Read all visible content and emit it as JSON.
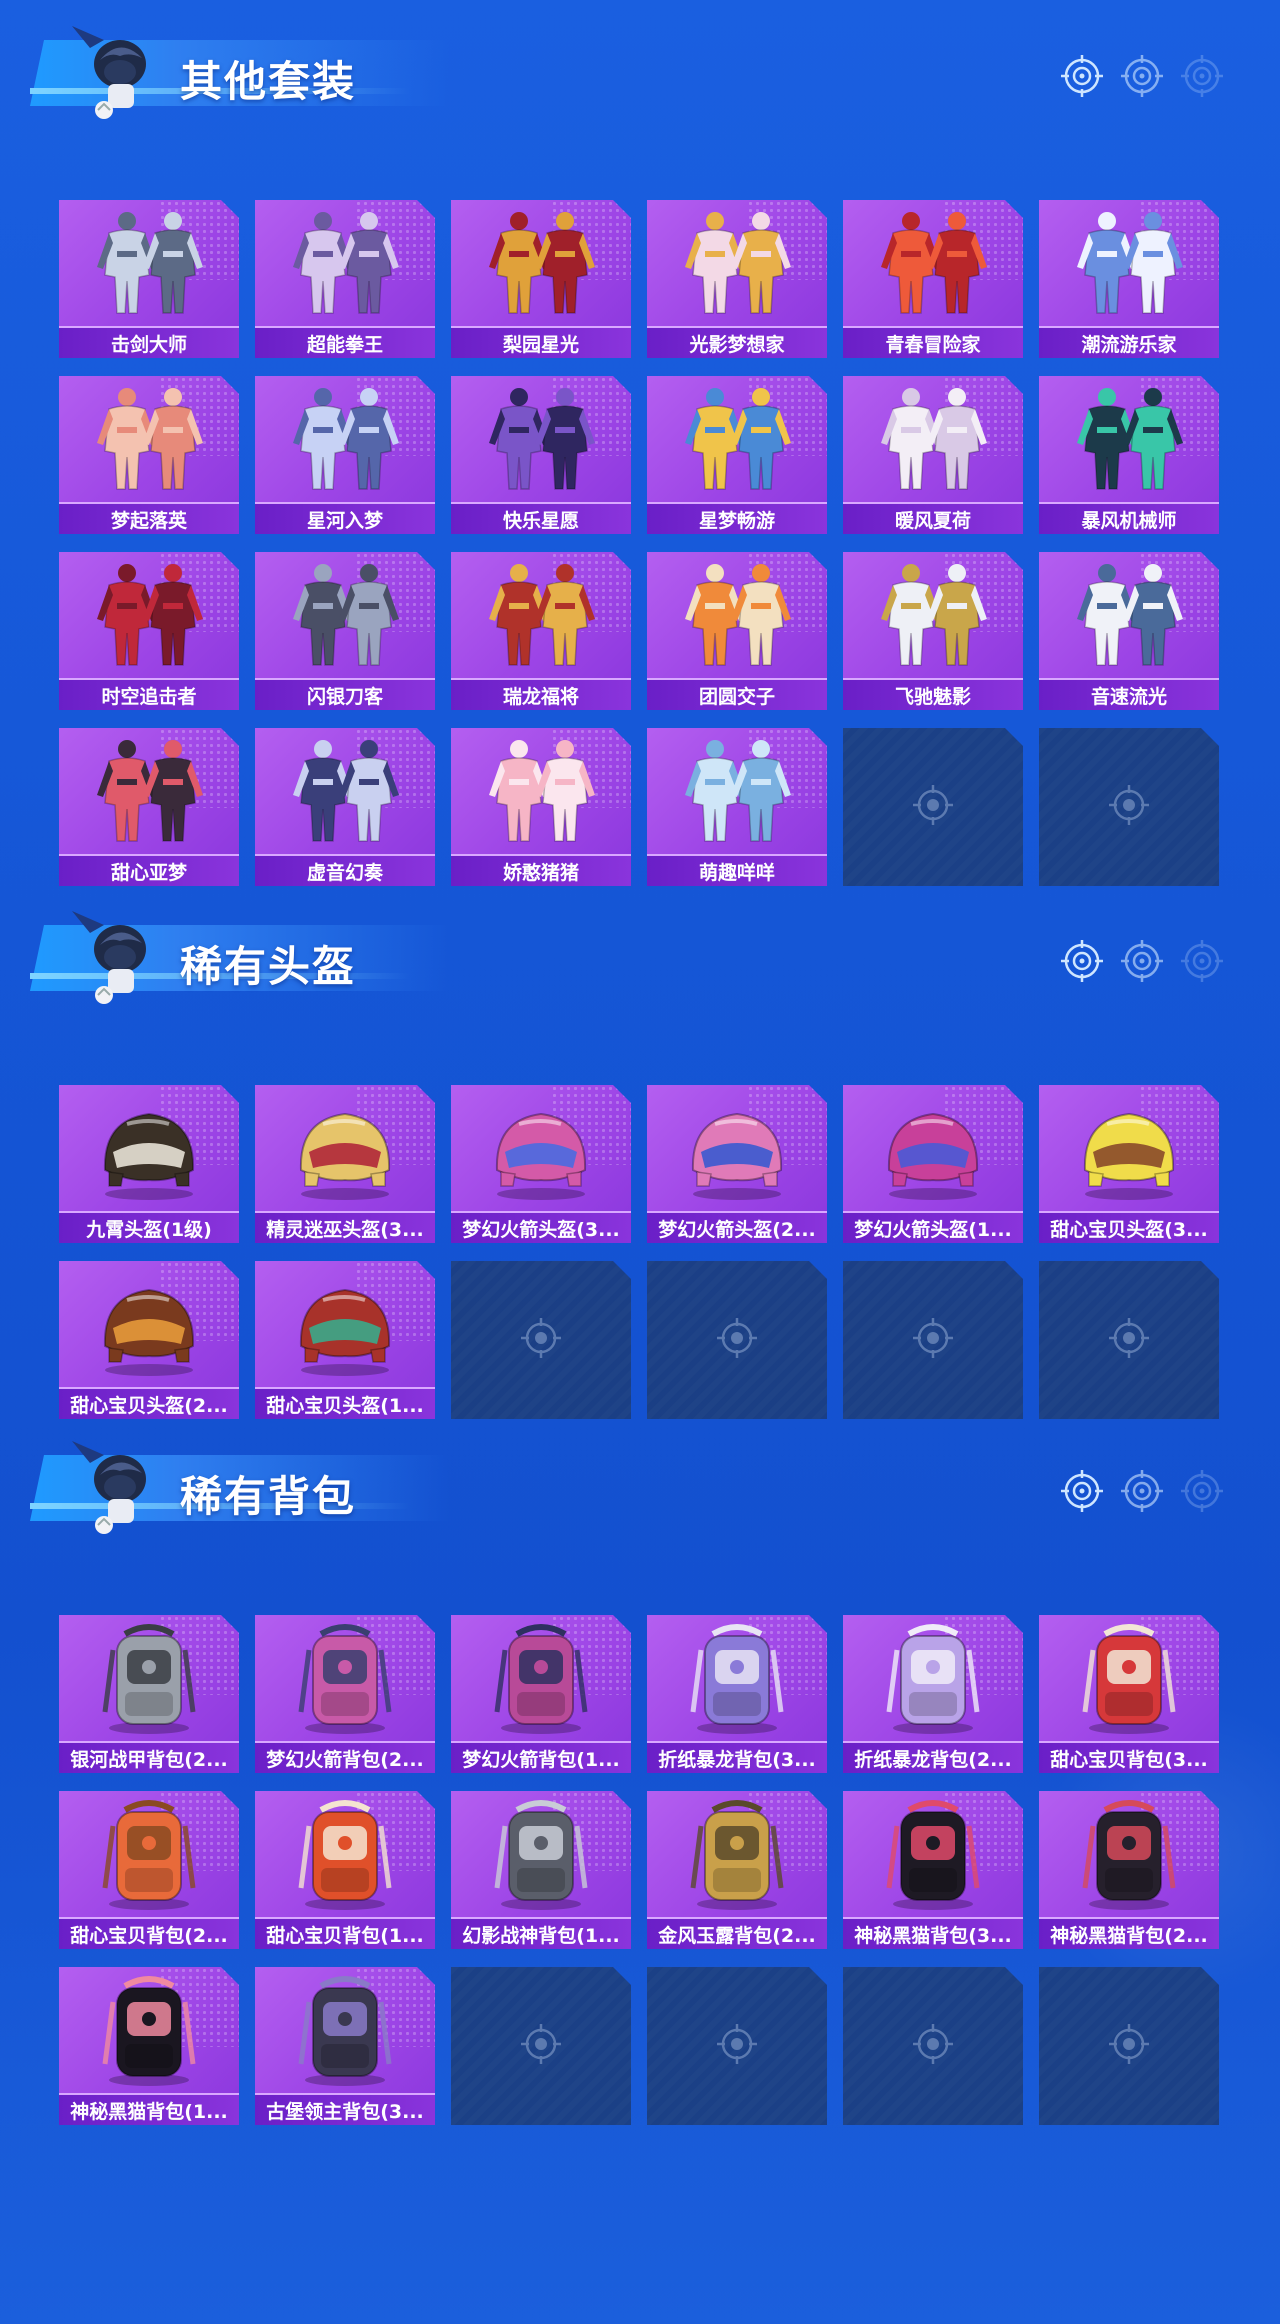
{
  "sections": [
    {
      "title": "其他套装",
      "items": [
        {
          "label": "击剑大师",
          "kind": "suit",
          "c1": "#c9d3e6",
          "c2": "#5c6a86"
        },
        {
          "label": "超能拳王",
          "kind": "suit",
          "c1": "#d7c7ee",
          "c2": "#6b5aa0"
        },
        {
          "label": "梨园星光",
          "kind": "suit",
          "c1": "#e0a13a",
          "c2": "#a0202a"
        },
        {
          "label": "光影梦想家",
          "kind": "suit",
          "c1": "#f3d9e6",
          "c2": "#e8b04a"
        },
        {
          "label": "青春冒险家",
          "kind": "suit",
          "c1": "#ee5a3a",
          "c2": "#b8262a"
        },
        {
          "label": "潮流游乐家",
          "kind": "suit",
          "c1": "#6a8fe0",
          "c2": "#eef2ff"
        },
        {
          "label": "梦起落英",
          "kind": "suit",
          "c1": "#f4c2b0",
          "c2": "#e78a7a"
        },
        {
          "label": "星河入梦",
          "kind": "suit",
          "c1": "#c7d2f5",
          "c2": "#5566aa"
        },
        {
          "label": "快乐星愿",
          "kind": "suit",
          "c1": "#7a55c8",
          "c2": "#2f2660"
        },
        {
          "label": "星梦畅游",
          "kind": "suit",
          "c1": "#f0c44a",
          "c2": "#4a8ad6"
        },
        {
          "label": "暖风夏荷",
          "kind": "suit",
          "c1": "#f3eef6",
          "c2": "#d9c9e6"
        },
        {
          "label": "暴风机械师",
          "kind": "suit",
          "c1": "#1c3a4a",
          "c2": "#39c6a8"
        },
        {
          "label": "时空追击者",
          "kind": "suit",
          "c1": "#c0283a",
          "c2": "#7a1a2a"
        },
        {
          "label": "闪银刀客",
          "kind": "suit",
          "c1": "#4a4f66",
          "c2": "#9aa4bf"
        },
        {
          "label": "瑞龙福将",
          "kind": "suit",
          "c1": "#b0322a",
          "c2": "#e6b04a"
        },
        {
          "label": "团圆交子",
          "kind": "suit",
          "c1": "#f08a3a",
          "c2": "#f3e0c0"
        },
        {
          "label": "飞驰魅影",
          "kind": "suit",
          "c1": "#eef0f6",
          "c2": "#c9a64a"
        },
        {
          "label": "音速流光",
          "kind": "suit",
          "c1": "#f0f2f8",
          "c2": "#4a6a9a"
        },
        {
          "label": "甜心亚梦",
          "kind": "suit",
          "c1": "#e05a6a",
          "c2": "#3a2a3a"
        },
        {
          "label": "虚音幻奏",
          "kind": "suit",
          "c1": "#3a3f7a",
          "c2": "#c9d0f0"
        },
        {
          "label": "娇憨猪猪",
          "kind": "suit",
          "c1": "#f6b5c6",
          "c2": "#fbe6ee"
        },
        {
          "label": "萌趣咩咩",
          "kind": "suit",
          "c1": "#cfe6f8",
          "c2": "#7ab0e0"
        }
      ],
      "empty_slots": 2
    },
    {
      "title": "稀有头盔",
      "items": [
        {
          "label": "九霄头盔(1级)",
          "kind": "helmet",
          "c1": "#3a3026",
          "c2": "#e8e2d6"
        },
        {
          "label": "精灵迷巫头盔(3...",
          "kind": "helmet",
          "c1": "#e6c46a",
          "c2": "#b0283a"
        },
        {
          "label": "梦幻火箭头盔(3...",
          "kind": "helmet",
          "c1": "#d45aa8",
          "c2": "#4a6ae0"
        },
        {
          "label": "梦幻火箭头盔(2...",
          "kind": "helmet",
          "c1": "#e07ab8",
          "c2": "#3a5ad0"
        },
        {
          "label": "梦幻火箭头盔(1...",
          "kind": "helmet",
          "c1": "#c8409a",
          "c2": "#4a5ad6"
        },
        {
          "label": "甜心宝贝头盔(3...",
          "kind": "helmet",
          "c1": "#f0dc4a",
          "c2": "#8a4a2a"
        },
        {
          "label": "甜心宝贝头盔(2...",
          "kind": "helmet",
          "c1": "#7a3a1e",
          "c2": "#e69a3a"
        },
        {
          "label": "甜心宝贝头盔(1...",
          "kind": "helmet",
          "c1": "#a8322a",
          "c2": "#3aa88a"
        }
      ],
      "empty_slots": 4
    },
    {
      "title": "稀有背包",
      "items": [
        {
          "label": "银河战甲背包(2...",
          "kind": "bag",
          "c1": "#9aa0aa",
          "c2": "#3a3d44"
        },
        {
          "label": "梦幻火箭背包(2...",
          "kind": "bag",
          "c1": "#c85aa8",
          "c2": "#3a3f70"
        },
        {
          "label": "梦幻火箭背包(1...",
          "kind": "bag",
          "c1": "#b84a98",
          "c2": "#2e3060"
        },
        {
          "label": "折纸暴龙背包(3...",
          "kind": "bag",
          "c1": "#8a7ad8",
          "c2": "#e8e4f4"
        },
        {
          "label": "折纸暴龙背包(2...",
          "kind": "bag",
          "c1": "#b9a3e8",
          "c2": "#f0ecf8"
        },
        {
          "label": "甜心宝贝背包(3...",
          "kind": "bag",
          "c1": "#d6383a",
          "c2": "#f2e6d6"
        },
        {
          "label": "甜心宝贝背包(2...",
          "kind": "bag",
          "c1": "#e86a3a",
          "c2": "#8a4a22"
        },
        {
          "label": "甜心宝贝背包(1...",
          "kind": "bag",
          "c1": "#e0502a",
          "c2": "#f4e4d0"
        },
        {
          "label": "幻影战神背包(1...",
          "kind": "bag",
          "c1": "#5a5e6a",
          "c2": "#c9ccd6"
        },
        {
          "label": "金风玉露背包(2...",
          "kind": "bag",
          "c1": "#c9a04a",
          "c2": "#5a4a2a"
        },
        {
          "label": "神秘黑猫背包(3...",
          "kind": "bag",
          "c1": "#1e1a24",
          "c2": "#e04a6a"
        },
        {
          "label": "神秘黑猫背包(2...",
          "kind": "bag",
          "c1": "#26202c",
          "c2": "#d64a5a"
        },
        {
          "label": "神秘黑猫背包(1...",
          "kind": "bag",
          "c1": "#1a1620",
          "c2": "#f08aa0"
        },
        {
          "label": "古堡领主背包(3...",
          "kind": "bag",
          "c1": "#3a3850",
          "c2": "#8a7ac8"
        }
      ],
      "empty_slots": 4
    }
  ]
}
